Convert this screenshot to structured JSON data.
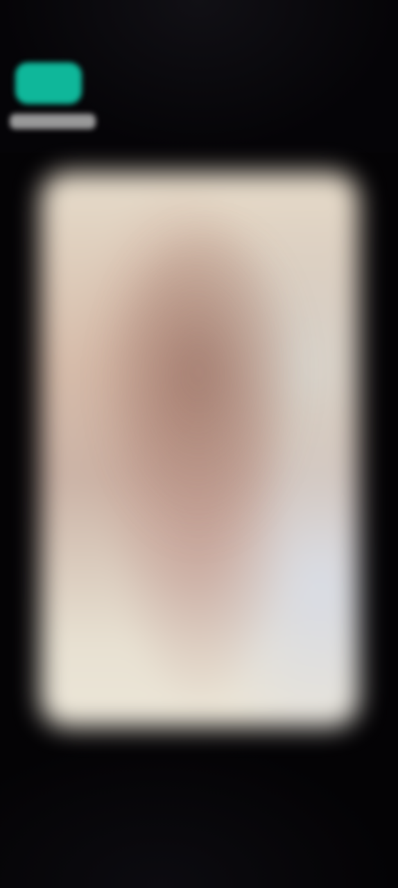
{
  "screen": {
    "background": "#040305"
  },
  "logo": {
    "icon": "app-logo-icon",
    "accent": "#0fb79a"
  },
  "media": {
    "content": "blurred-photo",
    "palette": [
      "#e6dccb",
      "#cbb3a6",
      "#d9dde6"
    ]
  }
}
